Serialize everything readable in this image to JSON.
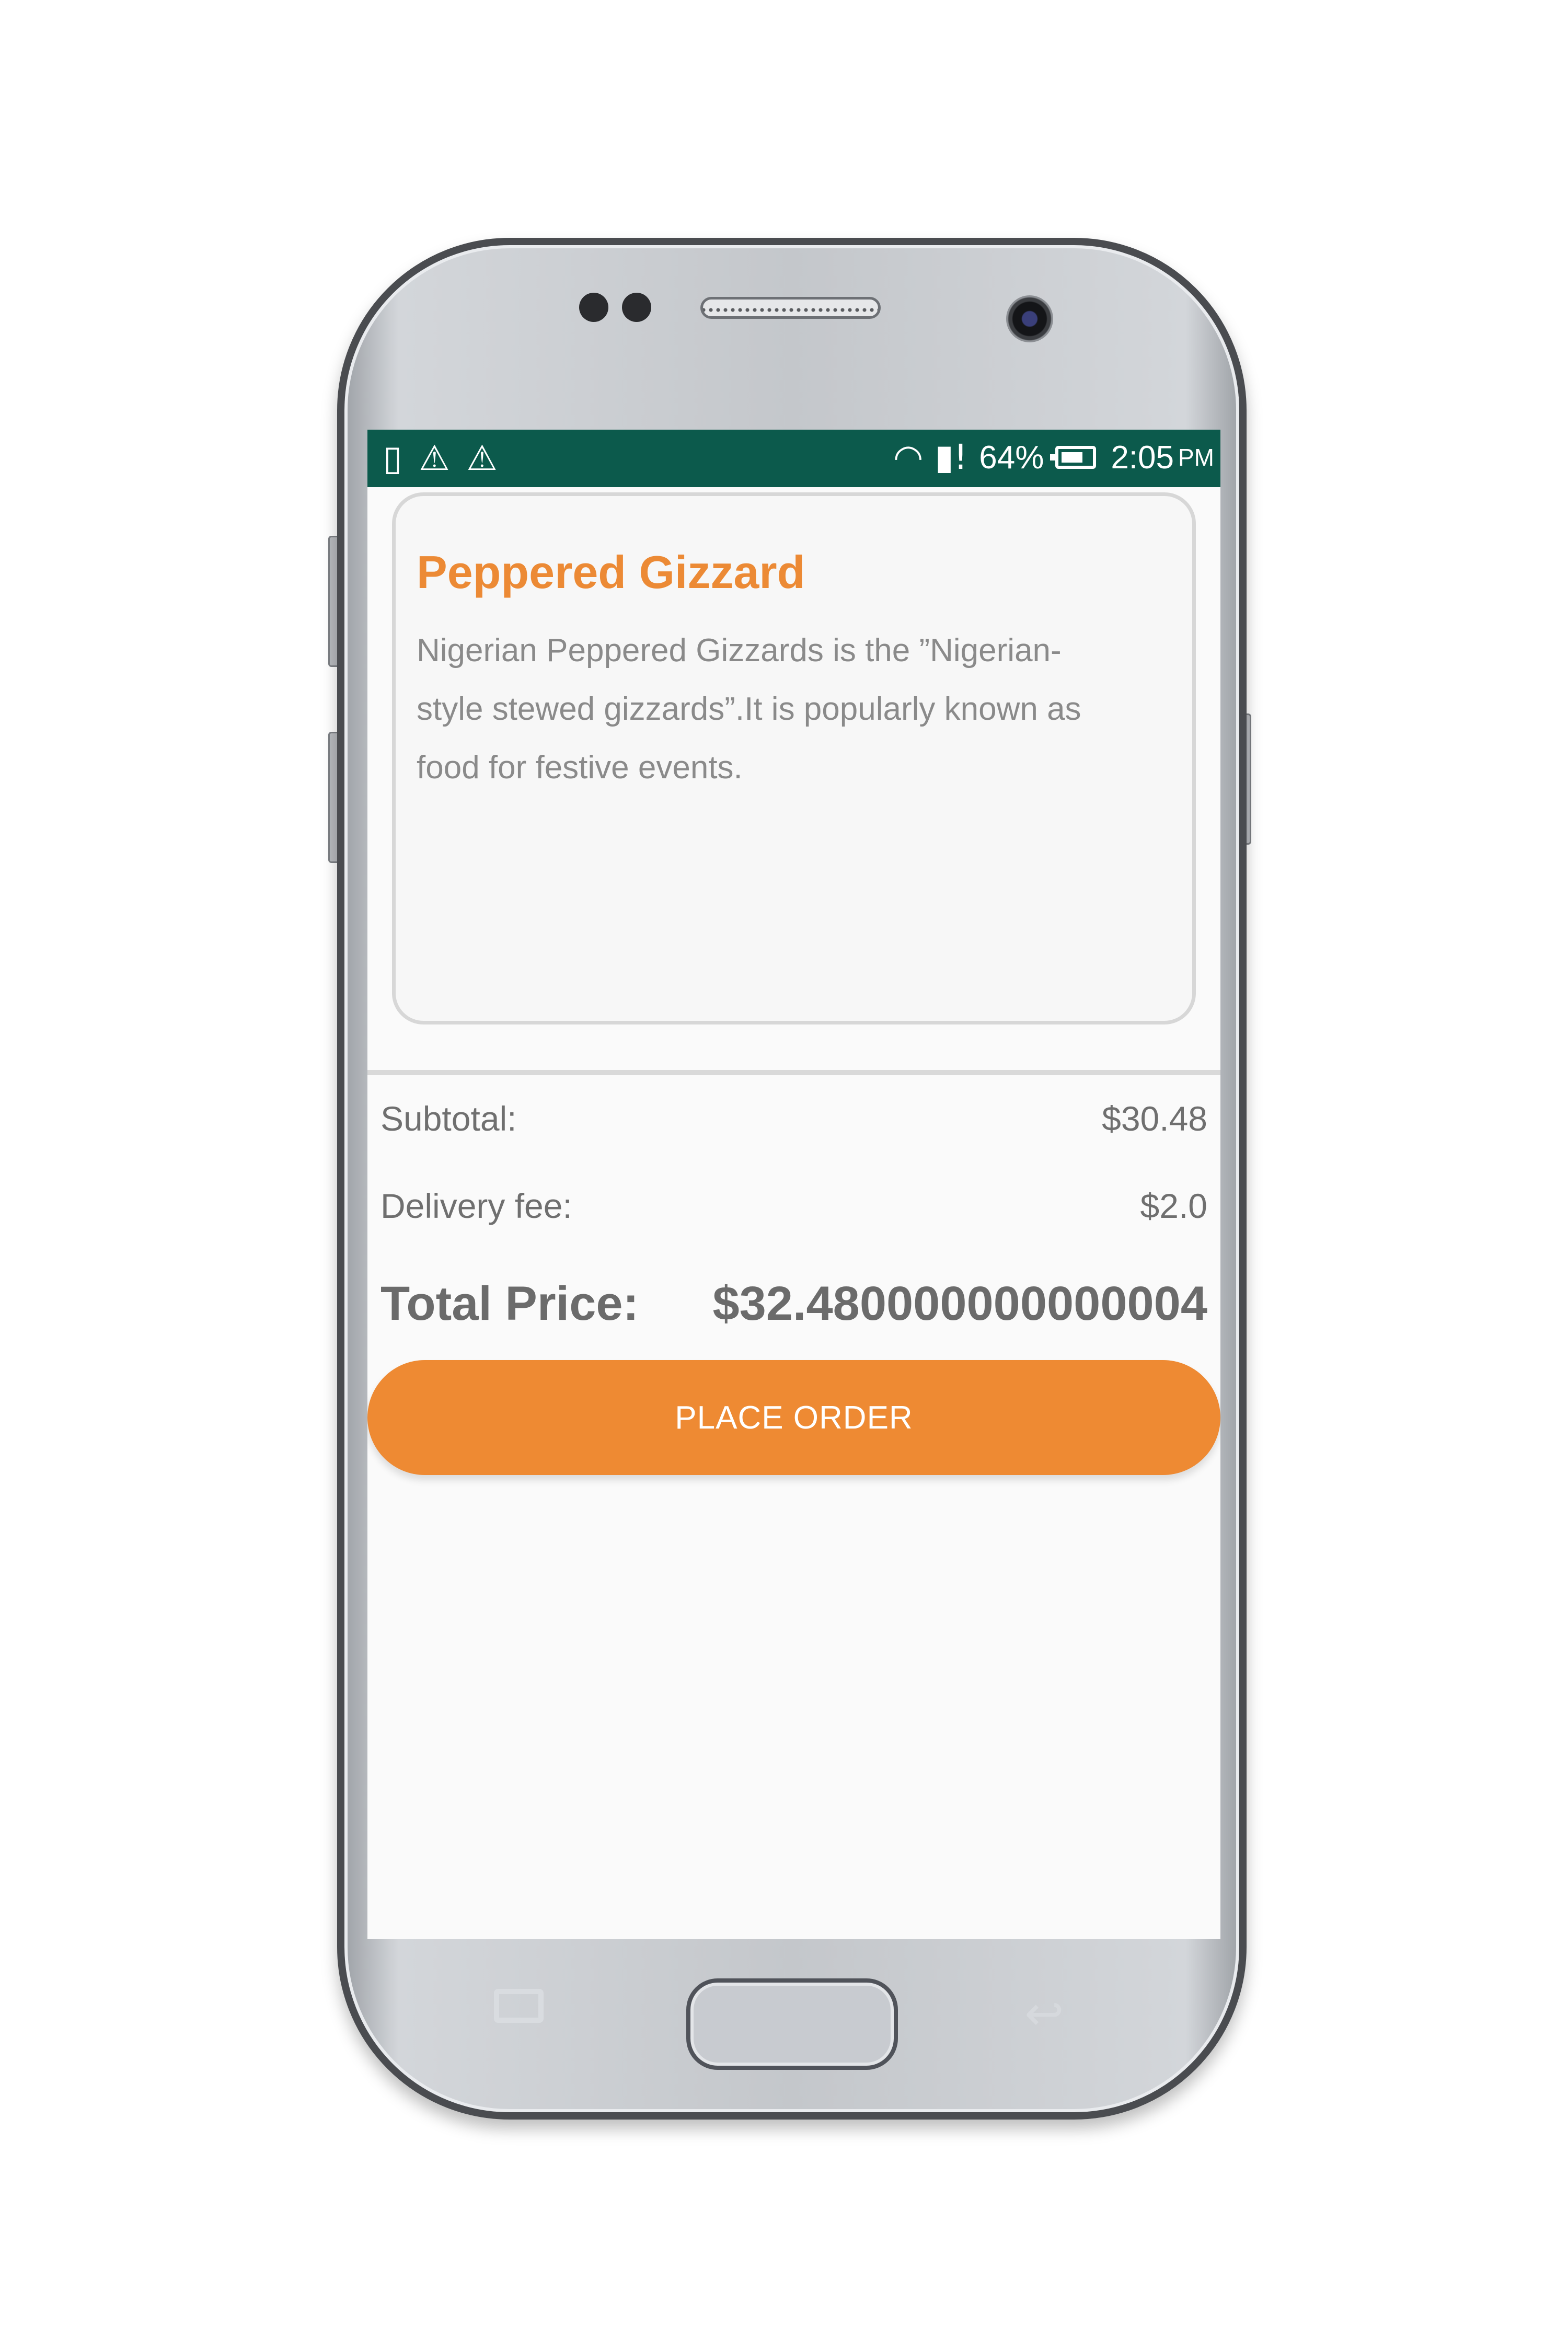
{
  "status_bar": {
    "icons_left": [
      "phone-sync-icon",
      "warning-icon",
      "warning-icon"
    ],
    "icons_right": [
      "wifi-icon",
      "sim-alert-icon",
      "battery-icon"
    ],
    "battery_percent": "64%",
    "time": "2:05",
    "ampm": "PM",
    "color": "#0c5a4c"
  },
  "product": {
    "title": "Peppered Gizzard",
    "description": "Nigerian Peppered Gizzards is the ”Nigerian-style stewed gizzards”.It is popularly known as food for festive events.",
    "title_color": "#ec8a35"
  },
  "summary": {
    "subtotal_label": "Subtotal:",
    "subtotal_value": "$30.48",
    "delivery_label": "Delivery fee:",
    "delivery_value": "$2.0",
    "total_label": "Total Price:",
    "total_value": "$32.480000000000004"
  },
  "actions": {
    "place_order_label": "PLACE ORDER",
    "accent_color": "#ee8a33"
  }
}
